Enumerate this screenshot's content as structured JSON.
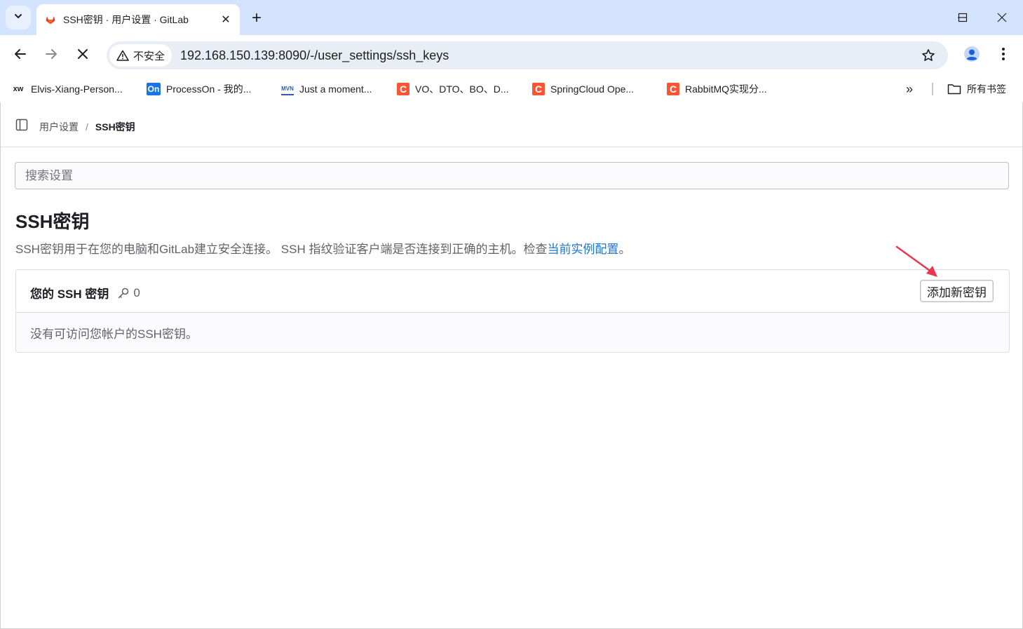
{
  "browser": {
    "tab": {
      "title": "SSH密钥 · 用户设置 · GitLab",
      "close_glyph": "✕"
    },
    "new_tab_glyph": "+",
    "address_bar": {
      "security_label": "不安全",
      "url": "192.168.150.139:8090/-/user_settings/ssh_keys"
    },
    "bookmarks": [
      {
        "label": "Elvis-Xiang-Person...",
        "icon": "xw",
        "color": "#1f1f1f"
      },
      {
        "label": "ProcessOn - 我的...",
        "icon": "On",
        "color": "#1a73e8"
      },
      {
        "label": "Just a moment...",
        "icon": "MVN",
        "color": "#2a5caa"
      },
      {
        "label": "VO、DTO、BO、D...",
        "icon": "C",
        "color": "#fc5531"
      },
      {
        "label": "SpringCloud Ope...",
        "icon": "C",
        "color": "#fc5531"
      },
      {
        "label": "RabbitMQ实现分...",
        "icon": "C",
        "color": "#fc5531"
      }
    ],
    "overflow_glyph": "»",
    "all_bookmarks_label": "所有书签"
  },
  "breadcrumb": {
    "parent": "用户设置",
    "separator": "/",
    "current": "SSH密钥"
  },
  "search": {
    "placeholder": "搜索设置",
    "value": ""
  },
  "main": {
    "title": "SSH密钥",
    "description_prefix": "SSH密钥用于在您的电脑和GitLab建立安全连接。 SSH 指纹验证客户端是否连接到正确的主机。检查",
    "description_link": "当前实例配置",
    "description_suffix": "。"
  },
  "keys_card": {
    "title": "您的 SSH 密钥",
    "count": "0",
    "add_button_label": "添加新密钥",
    "empty_message": "没有可访问您帐户的SSH密钥。"
  },
  "colors": {
    "tabstrip": "#d3e3fd",
    "link": "#1f75cb",
    "annotation_arrow": "#e8384f"
  }
}
